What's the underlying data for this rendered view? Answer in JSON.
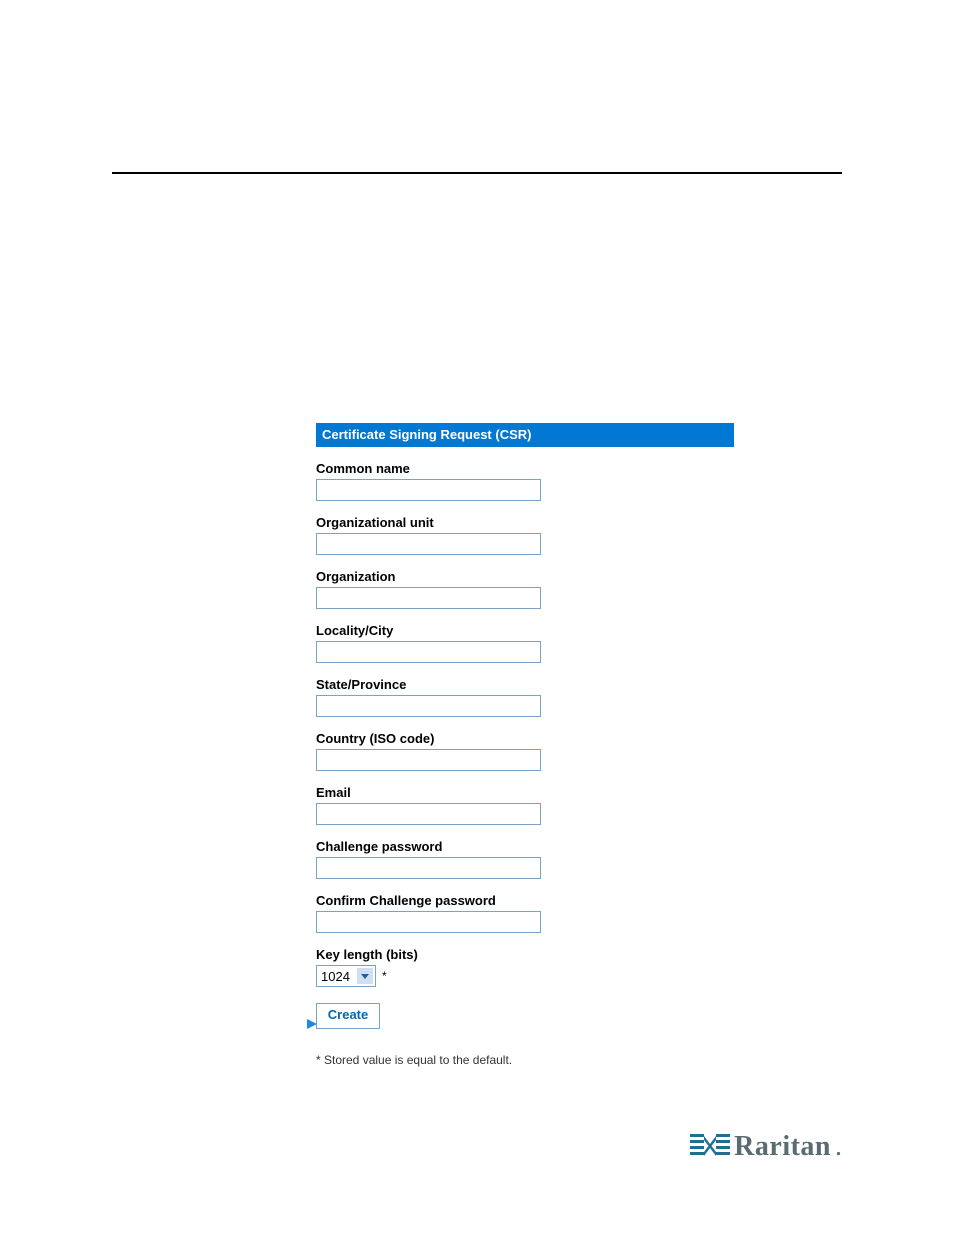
{
  "form": {
    "header": "Certificate Signing Request (CSR)",
    "common_name": {
      "label": "Common name",
      "value": ""
    },
    "org_unit": {
      "label": "Organizational unit",
      "value": ""
    },
    "organization": {
      "label": "Organization",
      "value": ""
    },
    "locality": {
      "label": "Locality/City",
      "value": ""
    },
    "state": {
      "label": "State/Province",
      "value": ""
    },
    "country": {
      "label": "Country (ISO code)",
      "value": ""
    },
    "email": {
      "label": "Email",
      "value": ""
    },
    "challenge_pw": {
      "label": "Challenge password",
      "value": ""
    },
    "confirm_pw": {
      "label": "Confirm Challenge password",
      "value": ""
    },
    "key_length": {
      "label": "Key length (bits)",
      "value": "1024",
      "asterisk": "*"
    },
    "create_label": "Create",
    "note": "* Stored value is equal to the default."
  },
  "brand": {
    "name": "Raritan",
    "dot": "."
  }
}
